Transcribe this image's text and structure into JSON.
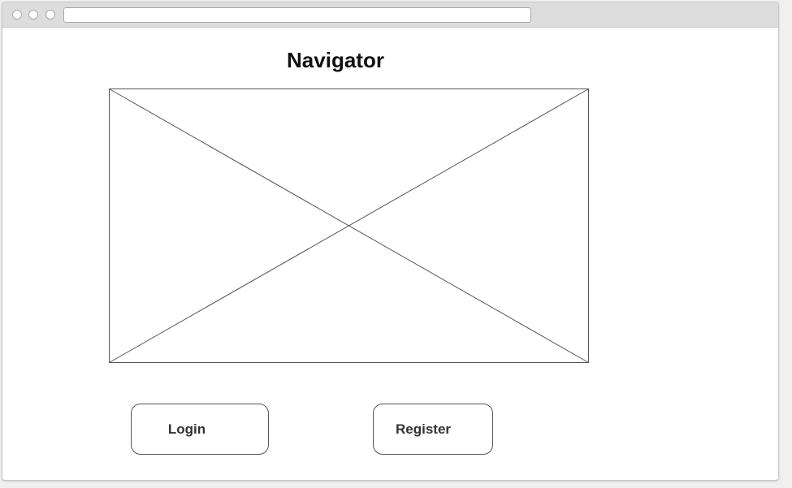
{
  "page": {
    "title": "Navigator"
  },
  "buttons": {
    "login_label": "Login",
    "register_label": "Register"
  },
  "colors": {
    "titlebar": "#dddddd",
    "page_background": "#ffffff",
    "outline": "#555555",
    "text": "#111111"
  },
  "icons": {
    "image_placeholder": "image-placeholder-icon"
  }
}
